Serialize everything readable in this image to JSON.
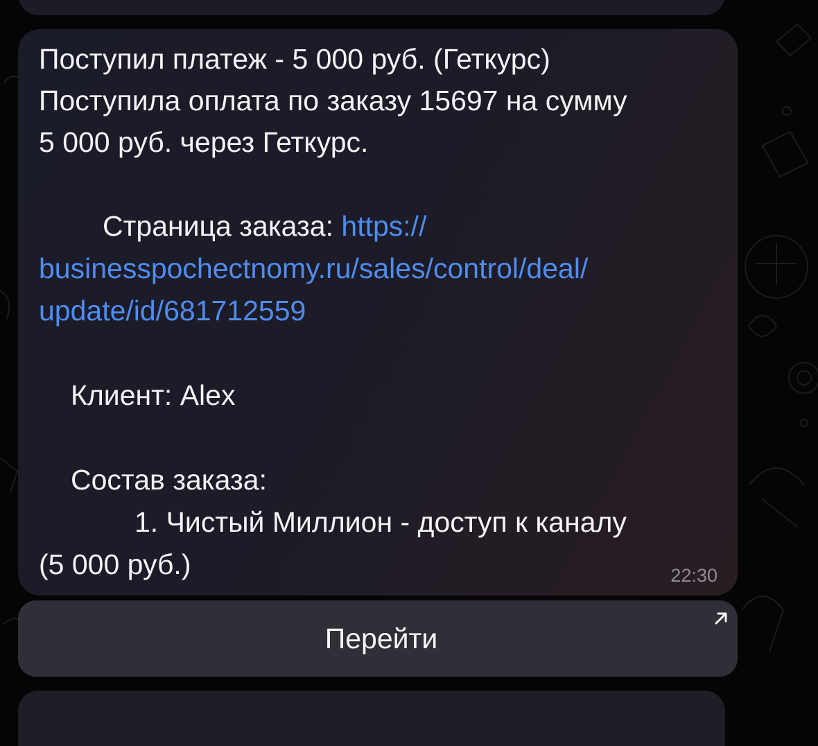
{
  "message": {
    "line1": "Поступил платеж - 5 000 руб. (Геткурс)",
    "line2": "Поступила оплата по заказу 15697 на сумму",
    "line3": "5 000 руб. через Геткурс.",
    "order_page_label": "Страница заказа:",
    "link_part1": "https://",
    "link_part2": "businesspochectnomy.ru/sales/control/deal/",
    "link_part3": "update/id/681712559",
    "client": "Клиент: Alex",
    "order_items_label": "Состав заказа:",
    "item1": "1. Чистый Миллион - доступ к каналу",
    "item1_price": "(5 000 руб.)",
    "time": "22:30"
  },
  "inline_button": {
    "label": "Перейти",
    "icon": "external-link-arrow-icon"
  },
  "next_message": {
    "partial_text": ""
  },
  "colors": {
    "background": "#050506",
    "bubble": "#1c1b27",
    "text": "#f4f4f6",
    "link": "#4f8cf0",
    "timestamp": "#8d8a94",
    "button": "#302e36"
  }
}
